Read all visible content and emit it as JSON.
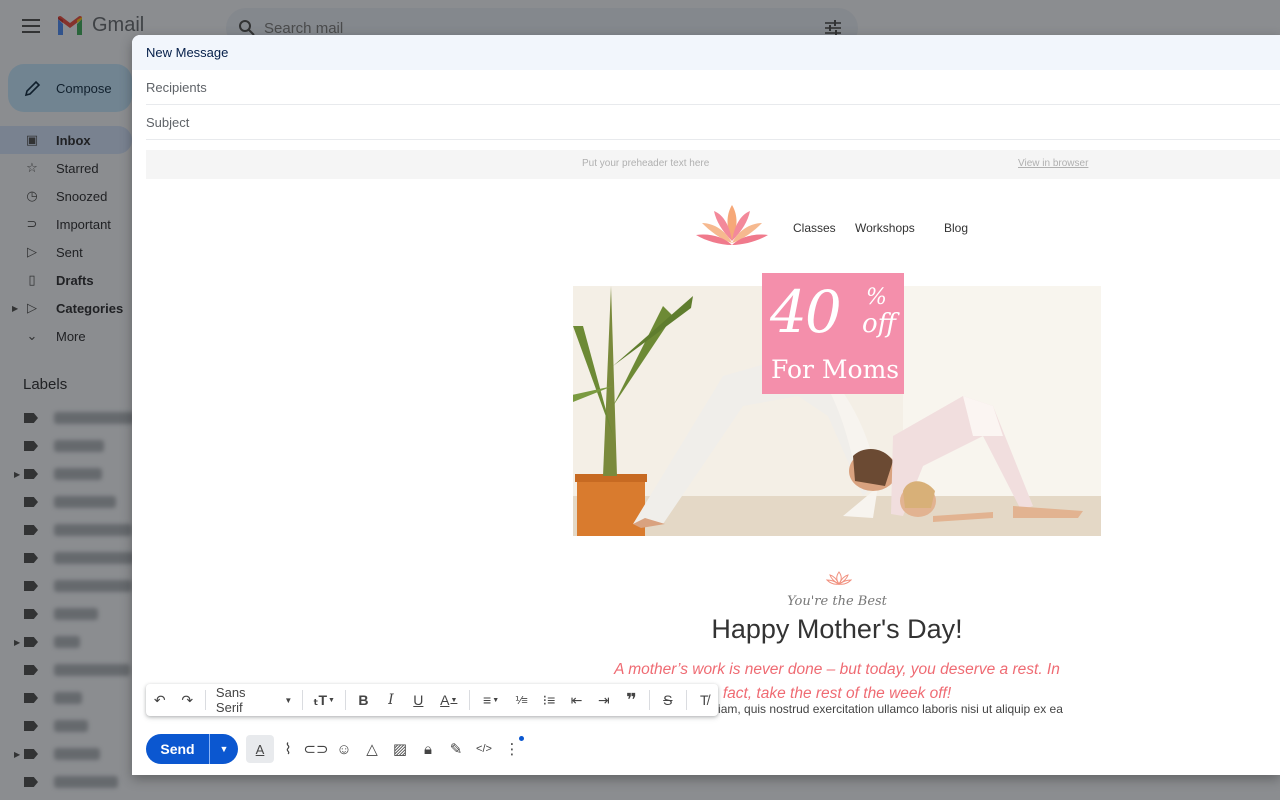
{
  "app": {
    "name": "Gmail",
    "search_placeholder": "Search mail"
  },
  "sidebar": {
    "compose_label": "Compose",
    "items": [
      {
        "label": "Inbox",
        "icon": "inbox-icon",
        "active": true
      },
      {
        "label": "Starred",
        "icon": "star-icon"
      },
      {
        "label": "Snoozed",
        "icon": "clock-icon"
      },
      {
        "label": "Important",
        "icon": "important-icon"
      },
      {
        "label": "Sent",
        "icon": "send-icon"
      },
      {
        "label": "Drafts",
        "icon": "draft-icon",
        "bold": true
      },
      {
        "label": "Categories",
        "icon": "label-icon",
        "bold": true
      },
      {
        "label": "More",
        "icon": "chevron-down-icon"
      }
    ],
    "labels_title": "Labels"
  },
  "compose": {
    "title": "New Message",
    "recipients_placeholder": "Recipients",
    "subject_placeholder": "Subject",
    "send_label": "Send"
  },
  "email": {
    "preheader": "Put your preheader text here",
    "view_in_browser": "View in browser",
    "nav_links": [
      "Classes",
      "Workshops",
      "Blog"
    ],
    "promo": {
      "number": "40",
      "percent": "%",
      "off": "off",
      "audience": "For Moms",
      "color": "#f48fab"
    },
    "eyebrow": "You're the Best",
    "headline": "Happy Mother's Day!",
    "subline": "A mother’s work is never done – but today, you deserve a rest. In fact, take the rest of the week off!",
    "body": "Ut enim ad minim veniam, quis nostrud exercitation ullamco laboris nisi ut aliquip ex ea"
  },
  "format_toolbar": {
    "font": "Sans Serif"
  },
  "colors": {
    "accent": "#0b57d0",
    "promo_pink": "#f48fab",
    "subline_coral": "#ef6b73"
  }
}
